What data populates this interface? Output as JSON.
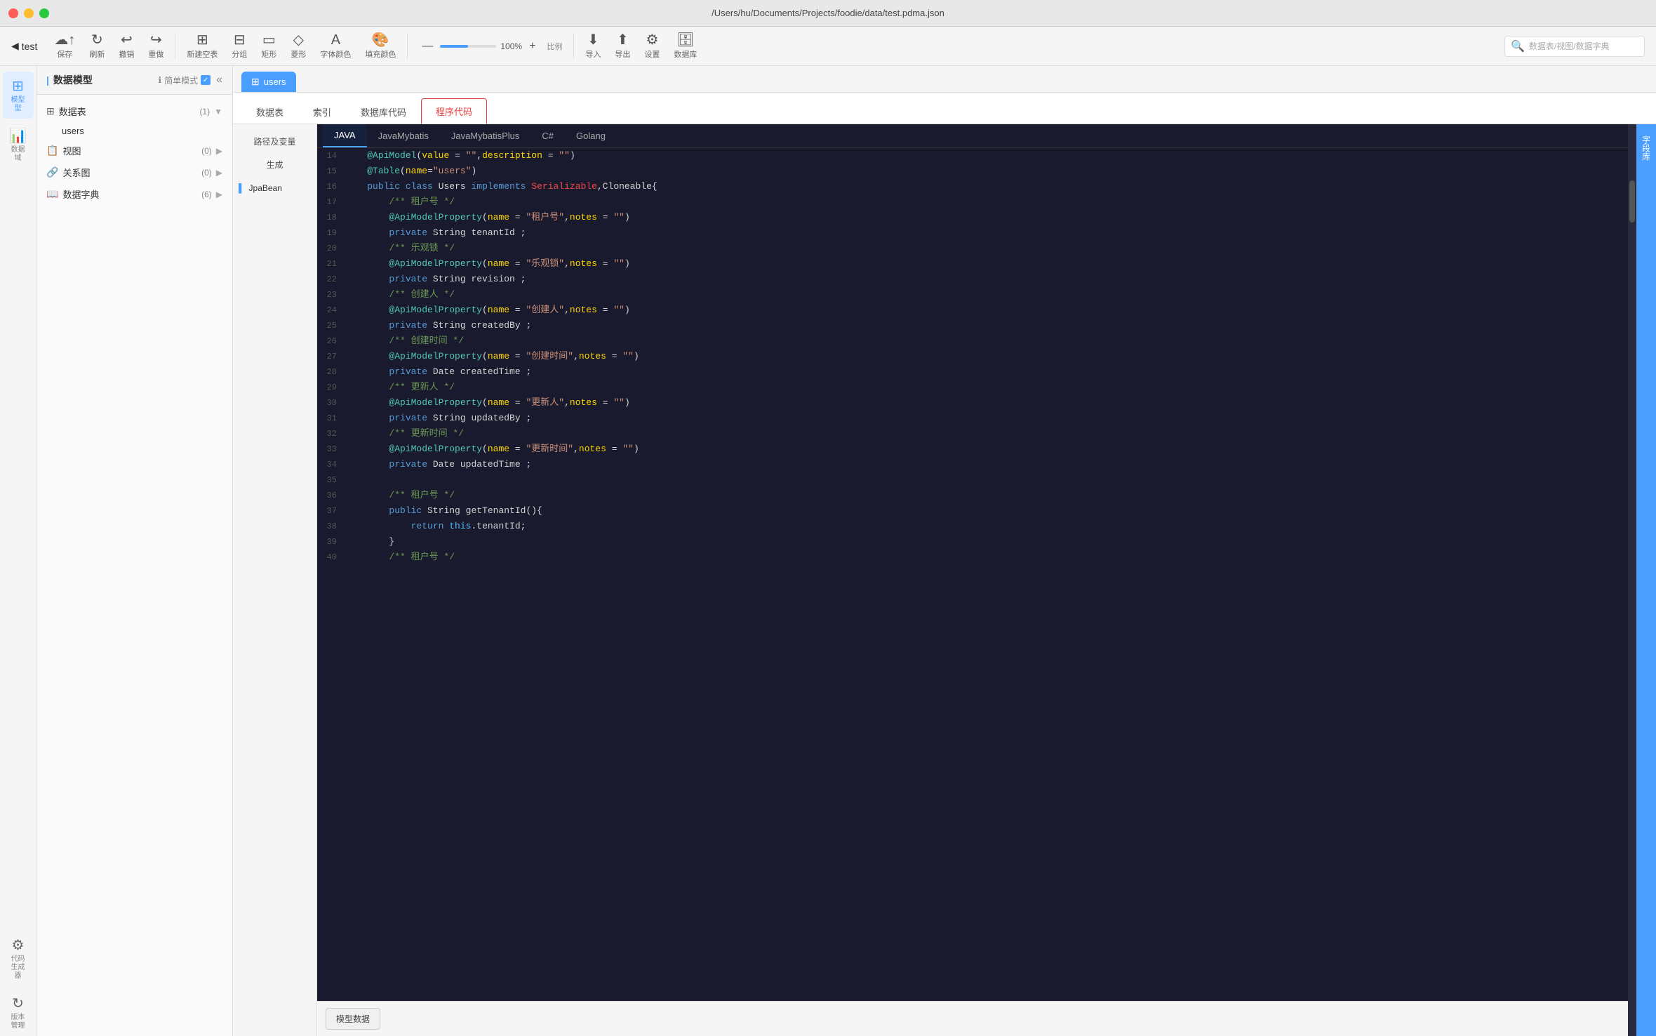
{
  "titlebar": {
    "title": "/Users/hu/Documents/Projects/foodie/data/test.pdma.json"
  },
  "toolbar": {
    "back_label": "test",
    "save_label": "保存",
    "refresh_label": "刷新",
    "undo_label": "撤销",
    "redo_label": "重做",
    "new_table_label": "新建空表",
    "split_label": "分组",
    "rect_label": "矩形",
    "diamond_label": "菱形",
    "font_color_label": "字体颜色",
    "fill_color_label": "填充颜色",
    "scale_minus": "—",
    "scale_value": "100%",
    "scale_plus": "+",
    "scale_label": "比例",
    "import_label": "导入",
    "export_label": "导出",
    "settings_label": "设置",
    "database_label": "数据库",
    "search_placeholder": "数据表/视图/数据字典"
  },
  "icon_sidebar": {
    "items": [
      {
        "id": "model",
        "label": "模型\n型",
        "icon": "⊞",
        "active": true
      },
      {
        "id": "datazone",
        "label": "数据\n域",
        "icon": "📊",
        "active": false
      },
      {
        "id": "codegen",
        "label": "代码\n生成\n器",
        "icon": "⚙",
        "active": false
      },
      {
        "id": "version",
        "label": "版本\n管理",
        "icon": "🔄",
        "active": false
      }
    ]
  },
  "left_panel": {
    "title": "数据模型",
    "simple_mode_label": "简单模式",
    "sections": [
      {
        "id": "tables",
        "icon": "⊞",
        "label": "数据表",
        "count": "(1)",
        "expanded": true,
        "children": [
          {
            "label": "users"
          }
        ]
      },
      {
        "id": "views",
        "icon": "📋",
        "label": "视图",
        "count": "(0)",
        "expanded": false,
        "children": []
      },
      {
        "id": "relations",
        "icon": "🔗",
        "label": "关系图",
        "count": "(0)",
        "expanded": false,
        "children": []
      },
      {
        "id": "dictionary",
        "icon": "📖",
        "label": "数据字典",
        "count": "(6)",
        "expanded": false,
        "children": []
      }
    ]
  },
  "tab_bar": {
    "current_table": "users"
  },
  "sub_tabs": {
    "tabs": [
      "数据表",
      "索引",
      "数据库代码",
      "程序代码"
    ],
    "active_index": 3
  },
  "lang_tabs": {
    "tabs": [
      "JAVA",
      "JavaMybatis",
      "JavaMybatisPlus",
      "C#",
      "Golang"
    ],
    "active_index": 0
  },
  "code_left_panel": {
    "buttons": [
      "路径及变量",
      "生成"
    ],
    "section": "JpaBean"
  },
  "code_lines": [
    {
      "num": "14",
      "content": "    @ApiModel(value = \"\",description = \"\")"
    },
    {
      "num": "15",
      "content": "    @Table(name=\"users\")"
    },
    {
      "num": "16",
      "content": "    public class Users implements Serializable,Cloneable{"
    },
    {
      "num": "17",
      "content": "        /** 租户号 */"
    },
    {
      "num": "18",
      "content": "        @ApiModelProperty(name = \"租户号\",notes = \"\")"
    },
    {
      "num": "19",
      "content": "        private String tenantId ;"
    },
    {
      "num": "20",
      "content": "        /** 乐观锁 */"
    },
    {
      "num": "21",
      "content": "        @ApiModelProperty(name = \"乐观锁\",notes = \"\")"
    },
    {
      "num": "22",
      "content": "        private String revision ;"
    },
    {
      "num": "23",
      "content": "        /** 创建人 */"
    },
    {
      "num": "24",
      "content": "        @ApiModelProperty(name = \"创建人\",notes = \"\")"
    },
    {
      "num": "25",
      "content": "        private String createdBy ;"
    },
    {
      "num": "26",
      "content": "        /** 创建时间 */"
    },
    {
      "num": "27",
      "content": "        @ApiModelProperty(name = \"创建时间\",notes = \"\")"
    },
    {
      "num": "28",
      "content": "        private Date createdTime ;"
    },
    {
      "num": "29",
      "content": "        /** 更新人 */"
    },
    {
      "num": "30",
      "content": "        @ApiModelProperty(name = \"更新人\",notes = \"\")"
    },
    {
      "num": "31",
      "content": "        private String updatedBy ;"
    },
    {
      "num": "32",
      "content": "        /** 更新时间 */"
    },
    {
      "num": "33",
      "content": "        @ApiModelProperty(name = \"更新时间\",notes = \"\")"
    },
    {
      "num": "34",
      "content": "        private Date updatedTime ;"
    },
    {
      "num": "35",
      "content": ""
    },
    {
      "num": "36",
      "content": "        /** 租户号 */"
    },
    {
      "num": "37",
      "content": "        public String getTenantId(){"
    },
    {
      "num": "38",
      "content": "            return this.tenantId;"
    },
    {
      "num": "39",
      "content": "        }"
    },
    {
      "num": "40",
      "content": "        /** 租户号 */"
    }
  ],
  "right_sidebar": {
    "label": "字段库"
  },
  "bottom_panel": {
    "model_data_label": "模型数据"
  },
  "colors": {
    "accent": "#4a9eff",
    "active_tab": "#e84040",
    "code_bg": "#1a1a2e",
    "keyword": "#569cd6",
    "string": "#ce9178",
    "annotation": "#4ec9b0",
    "comment": "#6a9955",
    "attr": "#ffd700"
  }
}
